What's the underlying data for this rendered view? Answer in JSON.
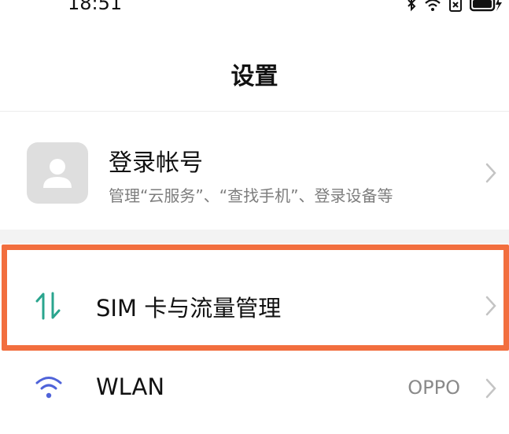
{
  "status_bar": {
    "time": "18:51",
    "icons": [
      "bluetooth-icon",
      "wifi-icon",
      "sim-icon",
      "battery-charging-icon"
    ]
  },
  "page": {
    "title": "设置"
  },
  "account": {
    "title": "登录帐号",
    "subtitle": "管理“云服务”、“查找手机”、登录设备等",
    "avatar_icon": "person-icon"
  },
  "settings": [
    {
      "label": "SIM 卡与流量管理",
      "icon": "data-arrows-icon",
      "value": ""
    },
    {
      "label": "WLAN",
      "icon": "wifi-icon",
      "value": "OPPO"
    }
  ],
  "colors": {
    "highlight": "#f26e3e",
    "sim_icon": "#2aa58e",
    "wlan_icon": "#4f63d9",
    "chevron": "#c4c4c4"
  }
}
